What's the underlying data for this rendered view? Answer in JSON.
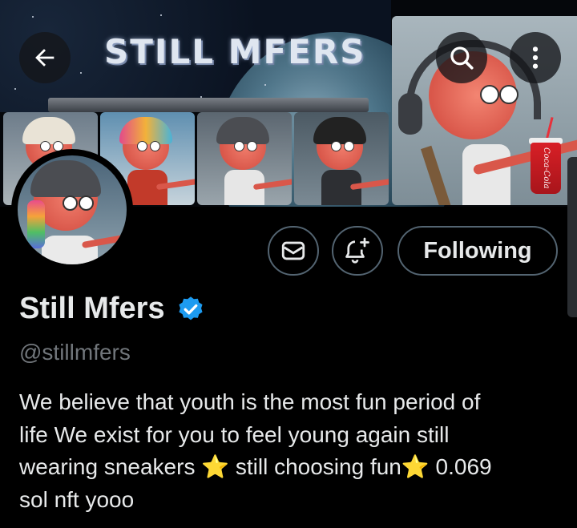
{
  "banner": {
    "title": "STILL MFERS",
    "soda_text": "Coca-Cola"
  },
  "nav": {
    "back_icon": "arrow-left-icon",
    "search_icon": "search-icon",
    "more_icon": "more-vertical-icon"
  },
  "actions": {
    "message_icon": "envelope-icon",
    "notify_icon": "bell-plus-icon",
    "follow_label": "Following"
  },
  "profile": {
    "display_name": "Still Mfers",
    "verified_icon": "verified-badge-icon",
    "handle": "@stillmfers",
    "bio": "We believe that youth is the most fun period of\nlife  We exist for you to feel young again  still\nwearing sneakers ⭐ still choosing fun⭐  0.069\nsol nft yooo"
  },
  "colors": {
    "background": "#000000",
    "text_primary": "#e7e9ea",
    "text_secondary": "#71767b",
    "border": "#536471",
    "verified_blue": "#1d9bf0"
  }
}
